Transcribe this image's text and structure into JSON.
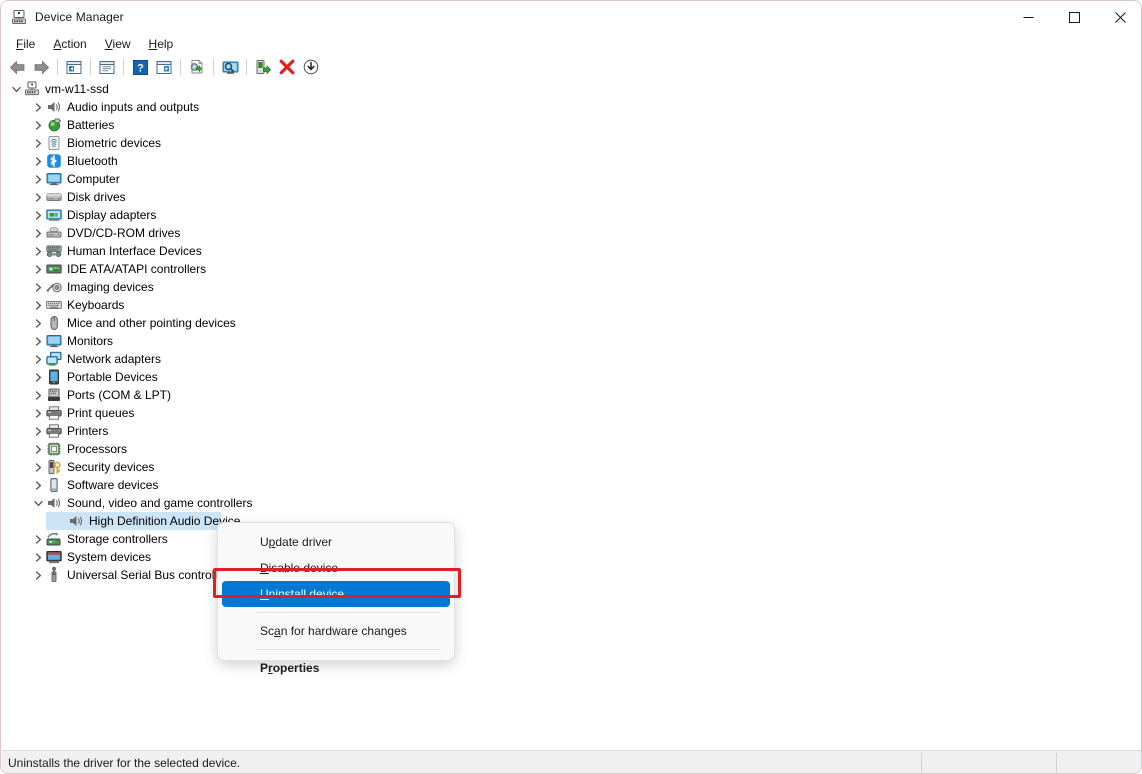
{
  "window": {
    "title": "Device Manager",
    "icon": "device-manager-icon",
    "controls": {
      "minimize": "—",
      "maximize": "□",
      "close": "✕"
    }
  },
  "menubar": {
    "items": [
      {
        "label": "File",
        "accel": "F"
      },
      {
        "label": "Action",
        "accel": "A"
      },
      {
        "label": "View",
        "accel": "V"
      },
      {
        "label": "Help",
        "accel": "H"
      }
    ]
  },
  "toolbar": {
    "buttons": [
      {
        "name": "back-icon",
        "title": "Back"
      },
      {
        "name": "forward-icon",
        "title": "Forward"
      },
      {
        "sep": true
      },
      {
        "name": "show-hide-console-tree-icon",
        "title": "Show/Hide Console Tree"
      },
      {
        "sep": true
      },
      {
        "name": "properties-icon",
        "title": "Properties"
      },
      {
        "sep": true
      },
      {
        "name": "help-icon",
        "title": "Help"
      },
      {
        "name": "show-hide-action-pane-icon",
        "title": "Show/Hide Action Pane"
      },
      {
        "sep": true
      },
      {
        "name": "update-driver-icon",
        "title": "Update Driver Software"
      },
      {
        "sep": true
      },
      {
        "name": "scan-hardware-changes-icon",
        "title": "Scan for hardware changes"
      },
      {
        "sep": true
      },
      {
        "name": "enable-device-icon",
        "title": "Enable device"
      },
      {
        "name": "uninstall-device-icon",
        "title": "Uninstall device"
      },
      {
        "name": "disable-device-icon",
        "title": "Disable device"
      }
    ]
  },
  "tree": {
    "root": {
      "label": "vm-w11-ssd",
      "icon": "computer-node-icon",
      "expanded": true
    },
    "items": [
      {
        "label": "Audio inputs and outputs",
        "icon": "speaker-icon",
        "indent": 1
      },
      {
        "label": "Batteries",
        "icon": "battery-icon",
        "indent": 1
      },
      {
        "label": "Biometric devices",
        "icon": "fingerprint-icon",
        "indent": 1
      },
      {
        "label": "Bluetooth",
        "icon": "bluetooth-icon",
        "indent": 1
      },
      {
        "label": "Computer",
        "icon": "monitor-icon",
        "indent": 1
      },
      {
        "label": "Disk drives",
        "icon": "disk-drive-icon",
        "indent": 1
      },
      {
        "label": "Display adapters",
        "icon": "display-adapter-icon",
        "indent": 1
      },
      {
        "label": "DVD/CD-ROM drives",
        "icon": "optical-drive-icon",
        "indent": 1
      },
      {
        "label": "Human Interface Devices",
        "icon": "hid-icon",
        "indent": 1
      },
      {
        "label": "IDE ATA/ATAPI controllers",
        "icon": "ide-controller-icon",
        "indent": 1
      },
      {
        "label": "Imaging devices",
        "icon": "imaging-icon",
        "indent": 1
      },
      {
        "label": "Keyboards",
        "icon": "keyboard-icon",
        "indent": 1
      },
      {
        "label": "Mice and other pointing devices",
        "icon": "mouse-icon",
        "indent": 1
      },
      {
        "label": "Monitors",
        "icon": "monitor-icon",
        "indent": 1
      },
      {
        "label": "Network adapters",
        "icon": "network-adapter-icon",
        "indent": 1
      },
      {
        "label": "Portable Devices",
        "icon": "portable-device-icon",
        "indent": 1
      },
      {
        "label": "Ports (COM & LPT)",
        "icon": "port-icon",
        "indent": 1
      },
      {
        "label": "Print queues",
        "icon": "printer-icon",
        "indent": 1
      },
      {
        "label": "Printers",
        "icon": "printer-icon",
        "indent": 1
      },
      {
        "label": "Processors",
        "icon": "processor-icon",
        "indent": 1
      },
      {
        "label": "Security devices",
        "icon": "security-device-icon",
        "indent": 1
      },
      {
        "label": "Software devices",
        "icon": "software-device-icon",
        "indent": 1
      },
      {
        "label": "Sound, video and game controllers",
        "icon": "speaker-icon",
        "indent": 1,
        "expanded": true
      },
      {
        "label": "High Definition Audio Device",
        "icon": "speaker-icon",
        "indent": 2,
        "selected": true,
        "leaf": true
      },
      {
        "label": "Storage controllers",
        "icon": "storage-controller-icon",
        "indent": 1
      },
      {
        "label": "System devices",
        "icon": "system-device-icon",
        "indent": 1
      },
      {
        "label": "Universal Serial Bus controllers",
        "icon": "usb-icon",
        "indent": 1
      }
    ]
  },
  "context_menu": {
    "items": [
      {
        "label": "Update driver",
        "accel": "p",
        "type": "normal"
      },
      {
        "label": "Disable device",
        "accel": "D",
        "type": "normal"
      },
      {
        "label": "Uninstall device",
        "accel": "U",
        "type": "highlight"
      },
      {
        "type": "separator"
      },
      {
        "label": "Scan for hardware changes",
        "accel": "a",
        "type": "normal"
      },
      {
        "type": "separator"
      },
      {
        "label": "Properties",
        "accel": "r",
        "type": "bold"
      }
    ],
    "highlight_color": "#0078d4",
    "annotation_color": "#e02020"
  },
  "statusbar": {
    "text": "Uninstalls the driver for the selected device.",
    "panel2": "",
    "panel3": ""
  }
}
